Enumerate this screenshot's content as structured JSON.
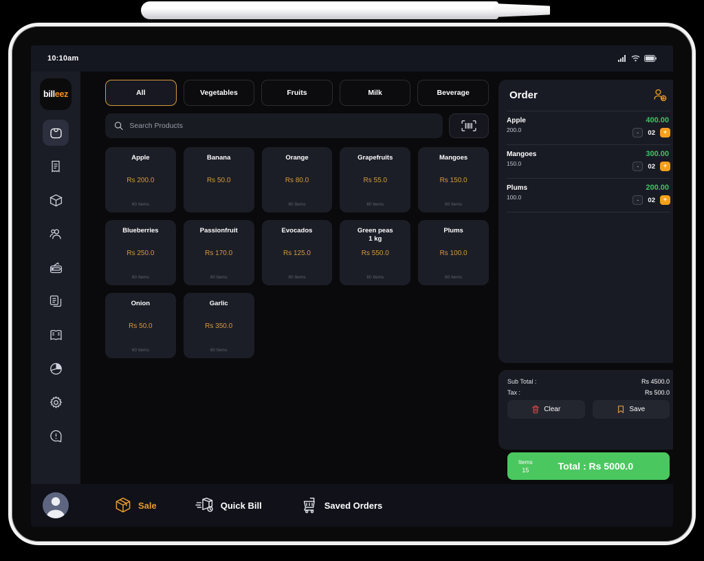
{
  "status_bar": {
    "time": "10:10am",
    "icons": [
      "signal-icon",
      "wifi-icon",
      "battery-icon"
    ]
  },
  "brand": {
    "part1": "bill",
    "part2": "eez"
  },
  "sidebar": {
    "items": [
      {
        "icon": "shopping-bag-icon",
        "name": "sidebar-item-sale",
        "active": true
      },
      {
        "icon": "receipt-icon",
        "name": "sidebar-item-bills",
        "active": false
      },
      {
        "icon": "package-box-icon",
        "name": "sidebar-item-inventory",
        "active": false
      },
      {
        "icon": "users-icon",
        "name": "sidebar-item-customers",
        "active": false
      },
      {
        "icon": "wallet-icon",
        "name": "sidebar-item-payments",
        "active": false
      },
      {
        "icon": "documents-icon",
        "name": "sidebar-item-documents",
        "active": false
      },
      {
        "icon": "book-icon",
        "name": "sidebar-item-ledger",
        "active": false
      },
      {
        "icon": "pie-chart-icon",
        "name": "sidebar-item-reports",
        "active": false
      },
      {
        "icon": "gear-icon",
        "name": "sidebar-item-settings",
        "active": false
      },
      {
        "icon": "alert-circle-icon",
        "name": "sidebar-item-help",
        "active": false
      }
    ]
  },
  "categories": [
    {
      "label": "All",
      "active": true
    },
    {
      "label": "Vegetables",
      "active": false
    },
    {
      "label": "Fruits",
      "active": false
    },
    {
      "label": "Milk",
      "active": false
    },
    {
      "label": "Beverage",
      "active": false
    }
  ],
  "search": {
    "placeholder": "Search Products",
    "value": "",
    "icon": "search-icon",
    "barcode_icon": "barcode-scanner-icon"
  },
  "products": [
    {
      "name": "Apple",
      "price": "Rs 200.0",
      "stock": "60 Items"
    },
    {
      "name": "Banana",
      "price": "Rs 50.0",
      "stock": ""
    },
    {
      "name": "Orange",
      "price": "Rs 80.0",
      "stock": "60 Items"
    },
    {
      "name": "Grapefruits",
      "price": "Rs 55.0",
      "stock": "60 Items"
    },
    {
      "name": "Mangoes",
      "price": "Rs 150.0",
      "stock": "60 Items"
    },
    {
      "name": "Blueberries",
      "price": "Rs 250.0",
      "stock": "60 Items"
    },
    {
      "name": "Passionfruit",
      "price": "Rs 170.0",
      "stock": "60 Items"
    },
    {
      "name": "Evocados",
      "price": "Rs 125.0",
      "stock": "60 Items"
    },
    {
      "name": "Green peas\n1 kg",
      "price": "Rs 550.0",
      "stock": "60 Items"
    },
    {
      "name": "Plums",
      "price": "Rs 100.0",
      "stock": "60 Items"
    },
    {
      "name": "Onion",
      "price": "Rs 50.0",
      "stock": "60 Items"
    },
    {
      "name": "Garlic",
      "price": "Rs 350.0",
      "stock": "60 Items"
    }
  ],
  "order": {
    "title": "Order",
    "add_customer_icon": "add-customer-icon",
    "items": [
      {
        "name": "Apple",
        "unit_price": "200.0",
        "amount": "400.00",
        "qty": "02"
      },
      {
        "name": "Mangoes",
        "unit_price": "150.0",
        "amount": "300.00",
        "qty": "02"
      },
      {
        "name": "Plums",
        "unit_price": "100.0",
        "amount": "200.00",
        "qty": "02"
      }
    ],
    "minus_label": "-",
    "plus_label": "+"
  },
  "summary": {
    "subtotal_label": "Sub Total :",
    "subtotal_value": "Rs 4500.0",
    "tax_label": "Tax :",
    "tax_value": "Rs 500.0",
    "clear_label": "Clear",
    "clear_icon": "trash-icon",
    "save_label": "Save",
    "save_icon": "bookmark-icon",
    "items_label": "Items",
    "items_count": "15",
    "total_label": "Total :  Rs 5000.0"
  },
  "bottom_nav": [
    {
      "label": "Sale",
      "icon": "package-icon",
      "active": true
    },
    {
      "label": "Quick Bill",
      "icon": "quick-bill-icon",
      "active": false
    },
    {
      "label": "Saved Orders",
      "icon": "cart-icon",
      "active": false
    }
  ],
  "colors": {
    "accent_orange": "#e69a2e",
    "accent_green": "#4bc75f",
    "amount_green": "#3fc463",
    "price_gold": "#d79a3f",
    "clear_red": "#e14b4b",
    "panel_bg": "#191b24",
    "card_bg": "#1c1e27"
  }
}
